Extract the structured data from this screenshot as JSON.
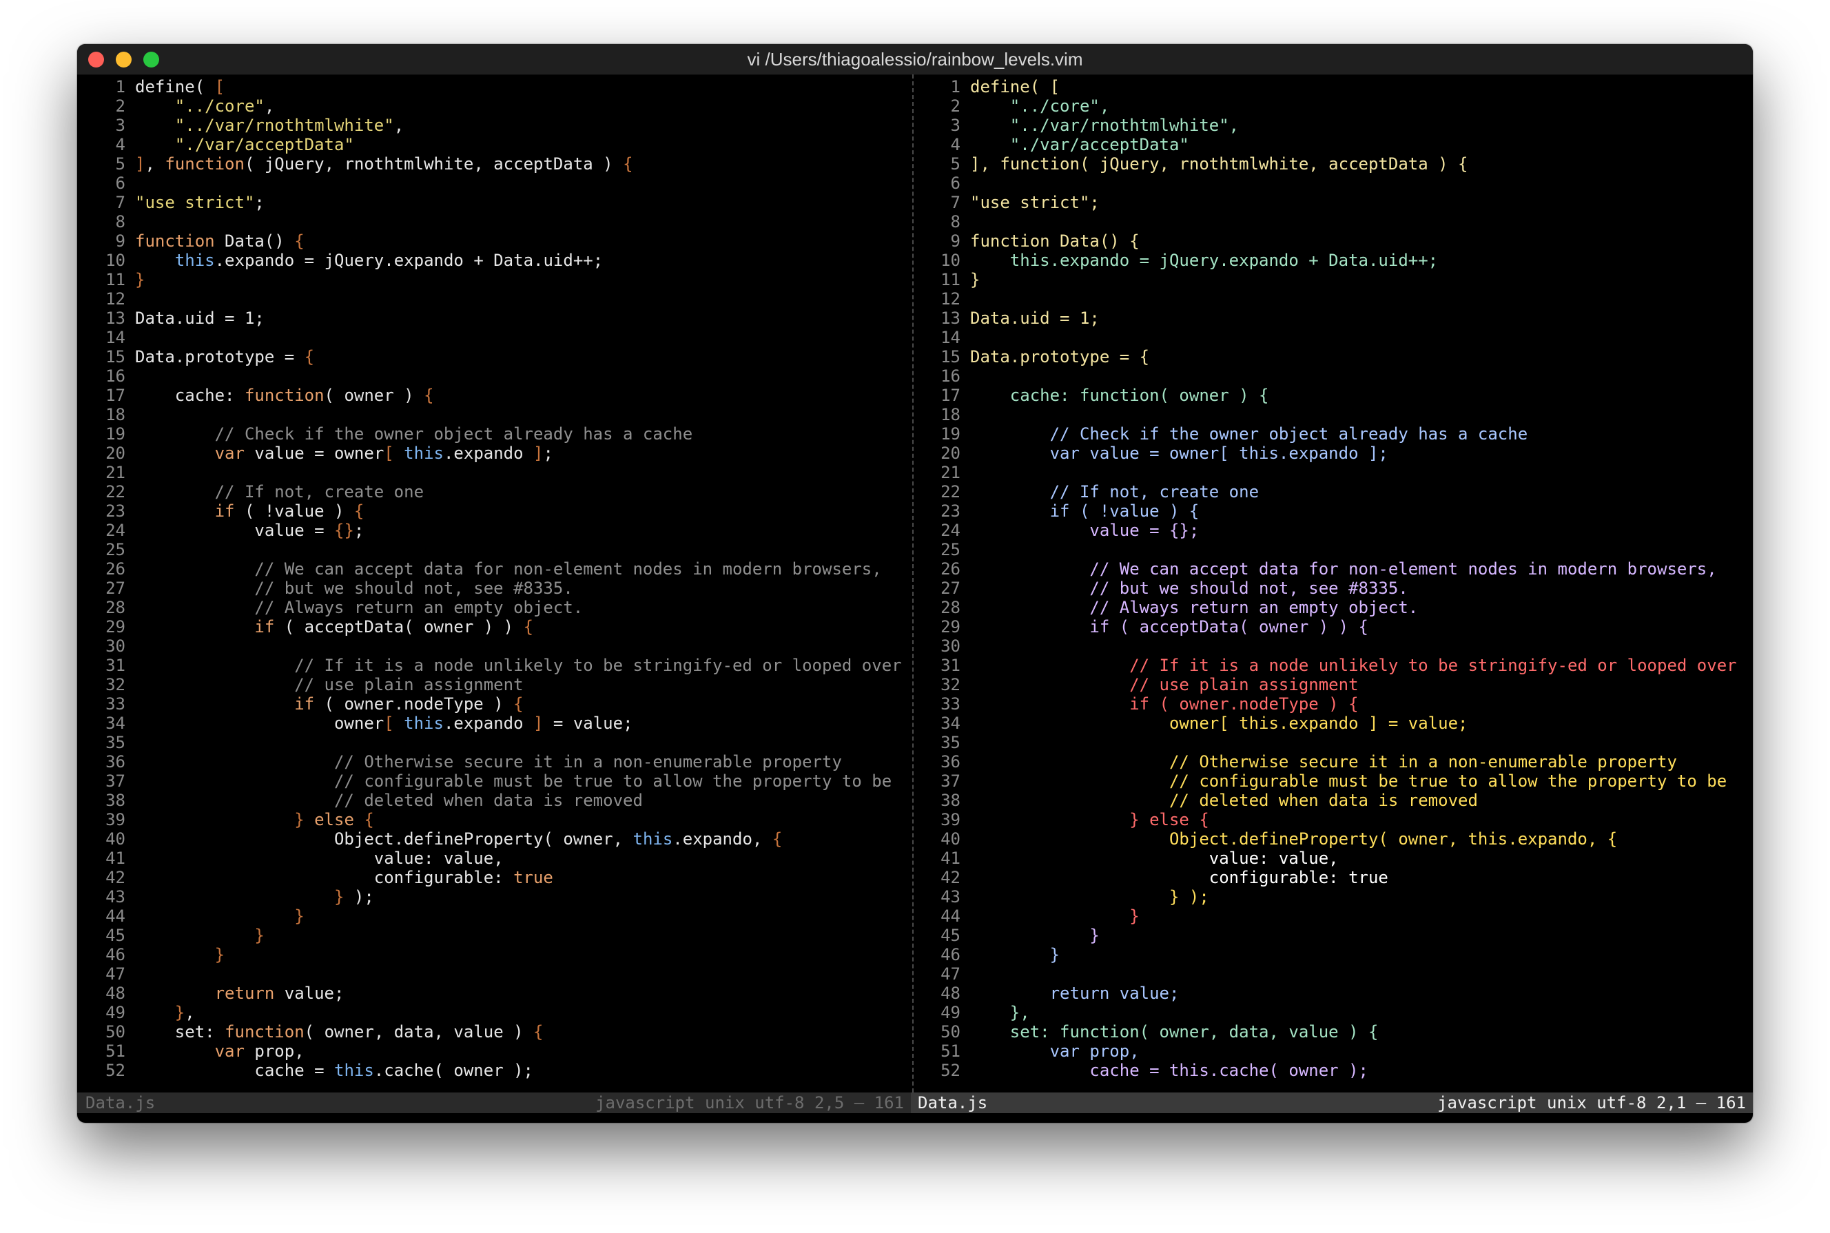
{
  "window": {
    "title": "vi  /Users/thiagoalessio/rainbow_levels.vim"
  },
  "code_lines": [
    "define( [",
    "    \"../core\",",
    "    \"../var/rnothtmlwhite\",",
    "    \"./var/acceptData\"",
    "], function( jQuery, rnothtmlwhite, acceptData ) {",
    "",
    "\"use strict\";",
    "",
    "function Data() {",
    "    this.expando = jQuery.expando + Data.uid++;",
    "}",
    "",
    "Data.uid = 1;",
    "",
    "Data.prototype = {",
    "",
    "    cache: function( owner ) {",
    "",
    "        // Check if the owner object already has a cache",
    "        var value = owner[ this.expando ];",
    "",
    "        // If not, create one",
    "        if ( !value ) {",
    "            value = {};",
    "",
    "            // We can accept data for non-element nodes in modern browsers,",
    "            // but we should not, see #8335.",
    "            // Always return an empty object.",
    "            if ( acceptData( owner ) ) {",
    "",
    "                // If it is a node unlikely to be stringify-ed or looped over",
    "                // use plain assignment",
    "                if ( owner.nodeType ) {",
    "                    owner[ this.expando ] = value;",
    "",
    "                    // Otherwise secure it in a non-enumerable property",
    "                    // configurable must be true to allow the property to be",
    "                    // deleted when data is removed",
    "                } else {",
    "                    Object.defineProperty( owner, this.expando, {",
    "                        value: value,",
    "                        configurable: true",
    "                    } );",
    "                }",
    "            }",
    "        }",
    "",
    "        return value;",
    "    },",
    "    set: function( owner, data, value ) {",
    "        var prop,",
    "            cache = this.cache( owner );"
  ],
  "status": {
    "left": {
      "file": "Data.js",
      "info": "javascript unix utf-8 2,5 – 161"
    },
    "right": {
      "file": "Data.js",
      "info": "javascript unix utf-8 2,1 – 161"
    }
  },
  "colors": {
    "background": "#000000",
    "titlebar": "#1f1f1f",
    "status_inactive": "#2a2a2a",
    "status_active": "#3a3a3a"
  }
}
